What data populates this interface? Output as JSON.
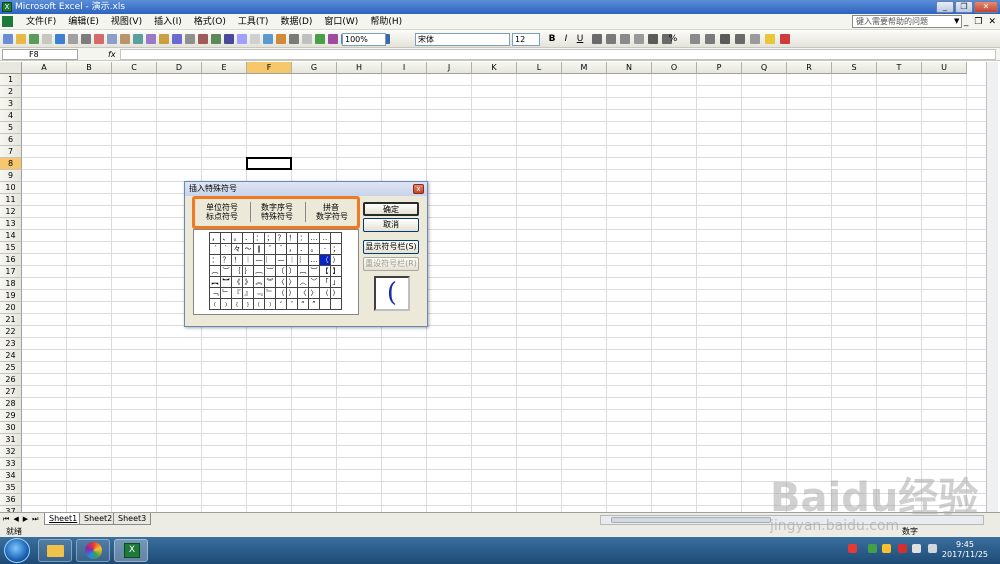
{
  "window": {
    "title": "Microsoft Excel - 演示.xls",
    "minimize": "_",
    "restore": "❐",
    "close": "✕"
  },
  "menubar": {
    "items": [
      "文件(F)",
      "编辑(E)",
      "视图(V)",
      "插入(I)",
      "格式(O)",
      "工具(T)",
      "数据(D)",
      "窗口(W)",
      "帮助(H)"
    ],
    "help_placeholder": "键入需要帮助的问题",
    "mdi_buttons": [
      "_",
      "❐",
      "✕"
    ]
  },
  "toolbar": {
    "zoom": "100%",
    "font_name": "宋体",
    "font_size": "12",
    "bold": "B",
    "italic": "I",
    "underline": "U",
    "percent": "%",
    "sum": "Σ"
  },
  "formula": {
    "name_box": "F8",
    "fx": "fx",
    "content": ""
  },
  "grid": {
    "columns": [
      "A",
      "B",
      "C",
      "D",
      "E",
      "F",
      "G",
      "H",
      "I",
      "J",
      "K",
      "L",
      "M",
      "N",
      "O",
      "P",
      "Q",
      "R",
      "S",
      "T",
      "U"
    ],
    "rows": [
      "1",
      "2",
      "3",
      "4",
      "5",
      "6",
      "7",
      "8",
      "9",
      "10",
      "11",
      "12",
      "13",
      "14",
      "15",
      "16",
      "17",
      "18",
      "19",
      "20",
      "21",
      "22",
      "23",
      "24",
      "25",
      "26",
      "27",
      "28",
      "29",
      "30",
      "31",
      "32",
      "33",
      "34",
      "35",
      "36",
      "37"
    ],
    "selected_column": "F",
    "selected_row": "8"
  },
  "sheets": {
    "tabs": [
      "Sheet1",
      "Sheet2",
      "Sheet3"
    ],
    "active": "Sheet1",
    "nav": [
      "⏮",
      "◀",
      "▶",
      "⏭"
    ]
  },
  "status": {
    "left": "就绪",
    "right": "数字"
  },
  "dialog": {
    "title": "插入特殊符号",
    "close": "x",
    "categories_row1": [
      "单位符号",
      "数字序号",
      "拼音"
    ],
    "categories_row2": [
      "标点符号",
      "特殊符号",
      "数学符号"
    ],
    "buttons": {
      "ok": "确定",
      "cancel": "取消",
      "show_bar": "显示符号栏(S)",
      "reset_bar": "重设符号栏(R)"
    },
    "symbols": [
      "，",
      "、",
      "。",
      "．",
      "：",
      "；",
      "？",
      "！",
      "：",
      "…",
      "‥",
      "",
      "ˊ",
      "ˋ",
      "々",
      "～",
      "‖",
      "ˇ",
      "¨",
      "，",
      "．",
      "。",
      "·",
      "；",
      "：",
      "？",
      "！",
      "︱",
      "—",
      "︳",
      "—",
      "︱",
      "︴",
      "…",
      "（",
      "）",
      "︵",
      "︶",
      "｛",
      "｝",
      "︷",
      "︸",
      "〔",
      "〕",
      "︹",
      "︺",
      "【",
      "】",
      "︻",
      "︼",
      "《",
      "》",
      "︽",
      "︾",
      "〈",
      "〉",
      "︿",
      "﹀",
      "「",
      "」",
      "﹁",
      "﹂",
      "『",
      "』",
      "﹃",
      "﹄",
      "（",
      "）",
      "〈",
      "〉",
      "（",
      "）",
      "﹙",
      "﹚",
      "﹛",
      "﹜",
      "﹝",
      "﹞",
      "‘",
      "’",
      "“",
      "”",
      "",
      ""
    ],
    "selected_symbol": "（",
    "preview": "("
  },
  "taskbar": {
    "time": "9:45",
    "date": "2017/11/25"
  },
  "watermark": {
    "text": "Baidu经验",
    "sub": "jingyan.baidu.com"
  },
  "colors": {
    "accent_orange": "#f07a21",
    "selected_header": "#f7c76b",
    "selection_blue": "#0a24c8"
  }
}
